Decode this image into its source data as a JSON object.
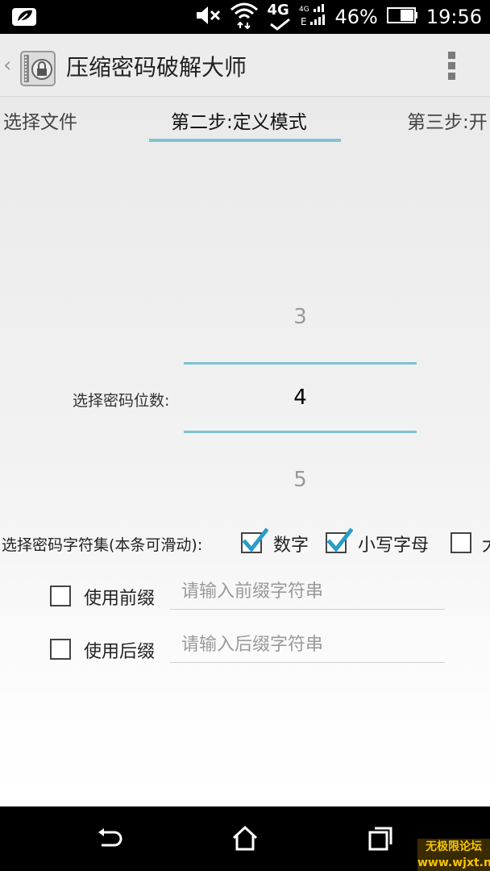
{
  "status_bar": {
    "network": "4G",
    "battery_percent": "46%",
    "time": "19:56",
    "icons": [
      "leaf-notification-icon",
      "mute-icon",
      "wifi-icon",
      "4g-icon",
      "signal-icon",
      "battery-icon"
    ]
  },
  "action_bar": {
    "title": "压缩密码破解大师",
    "back_icon": "chevron-left-icon",
    "menu_icon": "overflow-menu-icon"
  },
  "tabs": [
    {
      "label": "选择文件"
    },
    {
      "label": "第二步:定义模式"
    },
    {
      "label": "第三步:开"
    }
  ],
  "password_length": {
    "label": "选择密码位数:",
    "prev": "3",
    "current": "4",
    "next": "5"
  },
  "charset": {
    "label": "选择密码字符集(本条可滑动):",
    "options": [
      {
        "label": "数字",
        "checked": true
      },
      {
        "label": "小写字母",
        "checked": true
      },
      {
        "label": "大",
        "checked": false
      }
    ]
  },
  "prefix": {
    "label": "使用前缀",
    "checked": false,
    "placeholder": "请输入前缀字符串"
  },
  "suffix": {
    "label": "使用后缀",
    "checked": false,
    "placeholder": "请输入后缀字符串"
  },
  "colors": {
    "accent": "#7fc1d4",
    "check": "#2a9dc6"
  },
  "watermark": "无极限论坛 www.wjxt.net"
}
